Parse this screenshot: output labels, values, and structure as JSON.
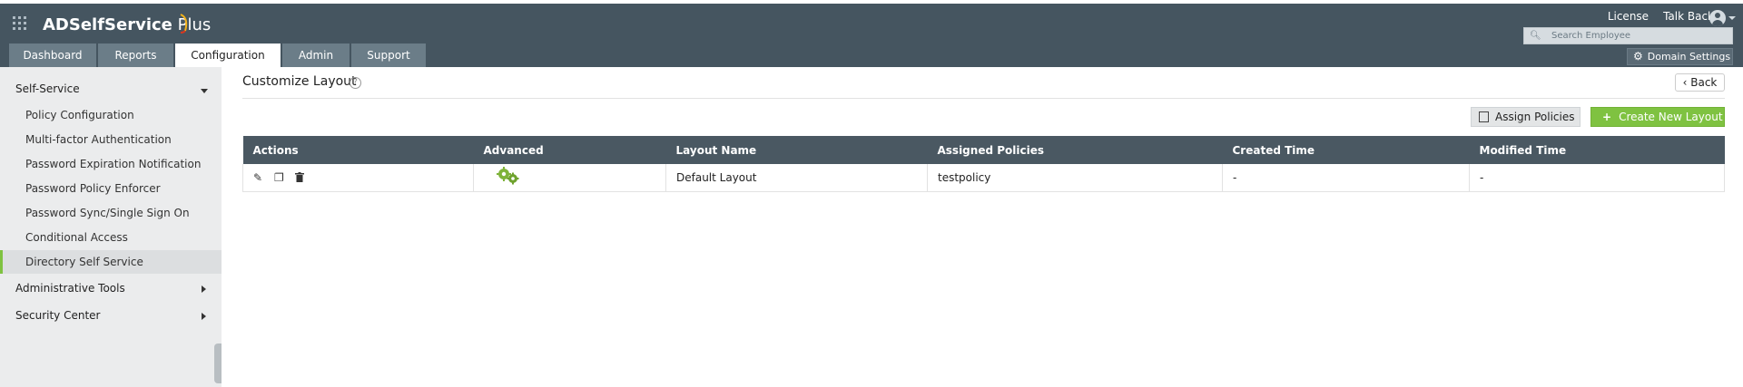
{
  "header": {
    "brand_main": "ADSelfService",
    "brand_sub": " Plus",
    "links": [
      "License",
      "Talk Back"
    ],
    "search_placeholder": "Search Employee",
    "domain_settings": "Domain Settings",
    "tabs": [
      {
        "label": "Dashboard"
      },
      {
        "label": "Reports"
      },
      {
        "label": "Configuration",
        "active": true
      },
      {
        "label": "Admin"
      },
      {
        "label": "Support"
      }
    ]
  },
  "sidebar": {
    "section_selfservice": "Self-Service",
    "items": [
      {
        "label": "Policy Configuration"
      },
      {
        "label": "Multi-factor Authentication"
      },
      {
        "label": "Password Expiration Notification"
      },
      {
        "label": "Password Policy Enforcer"
      },
      {
        "label": "Password Sync/Single Sign On"
      },
      {
        "label": "Conditional Access"
      },
      {
        "label": "Directory Self Service",
        "active": true
      }
    ],
    "section_admin_tools": "Administrative Tools",
    "section_security": "Security Center"
  },
  "main": {
    "title": "Customize Layout",
    "back_label": "Back",
    "assign_policies_label": "Assign Policies",
    "create_layout_label": "Create New Layout",
    "table": {
      "headers": [
        "Actions",
        "Advanced",
        "Layout Name",
        "Assigned Policies",
        "Created Time",
        "Modified Time"
      ],
      "rows": [
        {
          "layout_name": "Default Layout",
          "assigned_policies": "testpolicy",
          "created_time": "-",
          "modified_time": "-"
        }
      ]
    }
  },
  "colors": {
    "header_bg": "#455560",
    "accent_green": "#7fc241",
    "table_header_bg": "#4a5862"
  }
}
